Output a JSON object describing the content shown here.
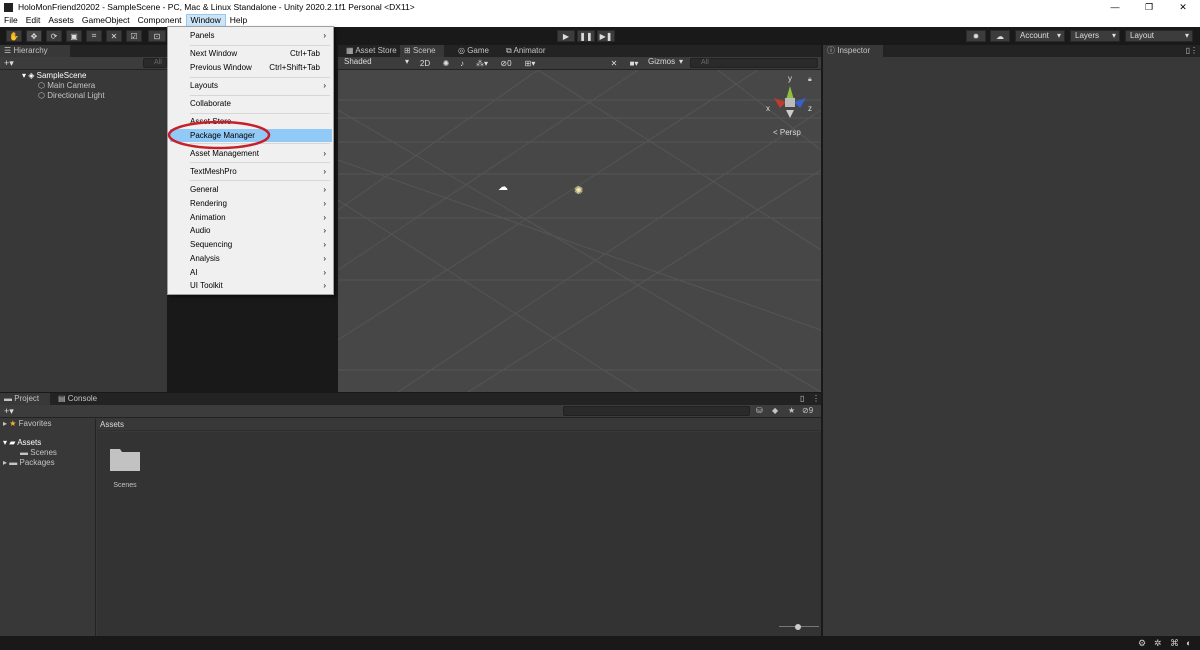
{
  "window": {
    "title": "HoloMonFriend20202 - SampleScene - PC, Mac & Linux Standalone - Unity 2020.2.1f1 Personal <DX11>",
    "controls": [
      "—",
      "❐",
      "✕"
    ]
  },
  "menubar": [
    "File",
    "Edit",
    "Assets",
    "GameObject",
    "Component",
    "Window",
    "Help"
  ],
  "toolbar": {
    "tools": [
      "✋",
      "✥",
      "⟳",
      "▣",
      "⌗",
      "✕",
      "☑"
    ],
    "play": "▶",
    "pause": "❚❚",
    "step": "▶❚",
    "account": "Account",
    "layers": "Layers",
    "layout": "Layout"
  },
  "hierarchy": {
    "tab": "Hierarchy",
    "add": "+▾",
    "search_placeholder": "All",
    "scene": "SampleScene",
    "items": [
      "Main Camera",
      "Directional Light"
    ]
  },
  "scene_tabs": [
    "Asset Store",
    "Scene",
    "Game",
    "Animator"
  ],
  "scene_toolbar": {
    "shading": "Shaded",
    "mode2d": "2D",
    "hidden_count": "0",
    "gizmos": "Gizmos",
    "search_placeholder": "All"
  },
  "gizmo": {
    "x": "x",
    "y": "y",
    "z": "z",
    "persp": "< Persp"
  },
  "inspector": {
    "tab": "Inspector"
  },
  "window_menu": {
    "items": [
      {
        "label": "Panels",
        "shortcut": "",
        "submenu": true
      },
      {
        "label": "Next Window",
        "shortcut": "Ctrl+Tab",
        "submenu": false
      },
      {
        "label": "Previous Window",
        "shortcut": "Ctrl+Shift+Tab",
        "submenu": false
      },
      {
        "label": "Layouts",
        "shortcut": "",
        "submenu": true
      },
      {
        "label": "Collaborate",
        "shortcut": "",
        "submenu": false
      },
      {
        "label": "Asset Store",
        "shortcut": "",
        "submenu": false
      },
      {
        "label": "Package Manager",
        "shortcut": "",
        "submenu": false
      },
      {
        "label": "Asset Management",
        "shortcut": "",
        "submenu": true
      },
      {
        "label": "TextMeshPro",
        "shortcut": "",
        "submenu": true
      },
      {
        "label": "General",
        "shortcut": "",
        "submenu": true
      },
      {
        "label": "Rendering",
        "shortcut": "",
        "submenu": true
      },
      {
        "label": "Animation",
        "shortcut": "",
        "submenu": true
      },
      {
        "label": "Audio",
        "shortcut": "",
        "submenu": true
      },
      {
        "label": "Sequencing",
        "shortcut": "",
        "submenu": true
      },
      {
        "label": "Analysis",
        "shortcut": "",
        "submenu": true
      },
      {
        "label": "AI",
        "shortcut": "",
        "submenu": true
      },
      {
        "label": "UI Toolkit",
        "shortcut": "",
        "submenu": true
      }
    ],
    "highlighted": "Package Manager"
  },
  "project": {
    "tabs": [
      "Project",
      "Console"
    ],
    "add": "+▾",
    "hidden_count": "9",
    "tree": {
      "favorites": "Favorites",
      "assets": "Assets",
      "scenes": "Scenes",
      "packages": "Packages"
    },
    "breadcrumb": "Assets",
    "folders": [
      "Scenes"
    ]
  },
  "colors": {
    "accent_highlight": "#91c9f7",
    "annotation_red": "#c8202a",
    "axis_x": "#c23a2e",
    "axis_y": "#8fc23a",
    "axis_z": "#3a5fcf"
  }
}
